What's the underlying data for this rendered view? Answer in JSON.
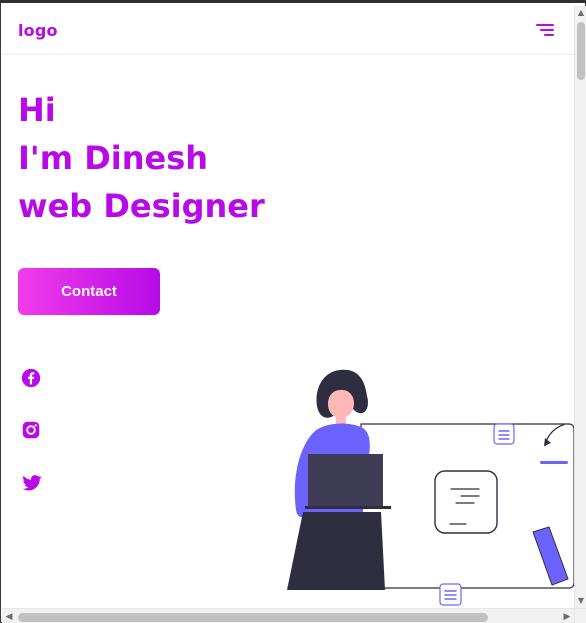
{
  "header": {
    "logo_text": "logo"
  },
  "hero": {
    "line1": "Hi",
    "line2": "I'm Dinesh",
    "line3": "web Designer"
  },
  "cta": {
    "contact_label": "Contact"
  },
  "social": {
    "icons": [
      "facebook-icon",
      "instagram-icon",
      "twitter-icon"
    ]
  },
  "scrollbars": {
    "up_arrow": "▲",
    "down_arrow": "▼",
    "left_arrow": "◀",
    "right_arrow": "▶"
  },
  "theme": {
    "primary": "#B70AE7",
    "gradient_start": "#F23CEA",
    "gradient_end": "#B70AE7"
  }
}
